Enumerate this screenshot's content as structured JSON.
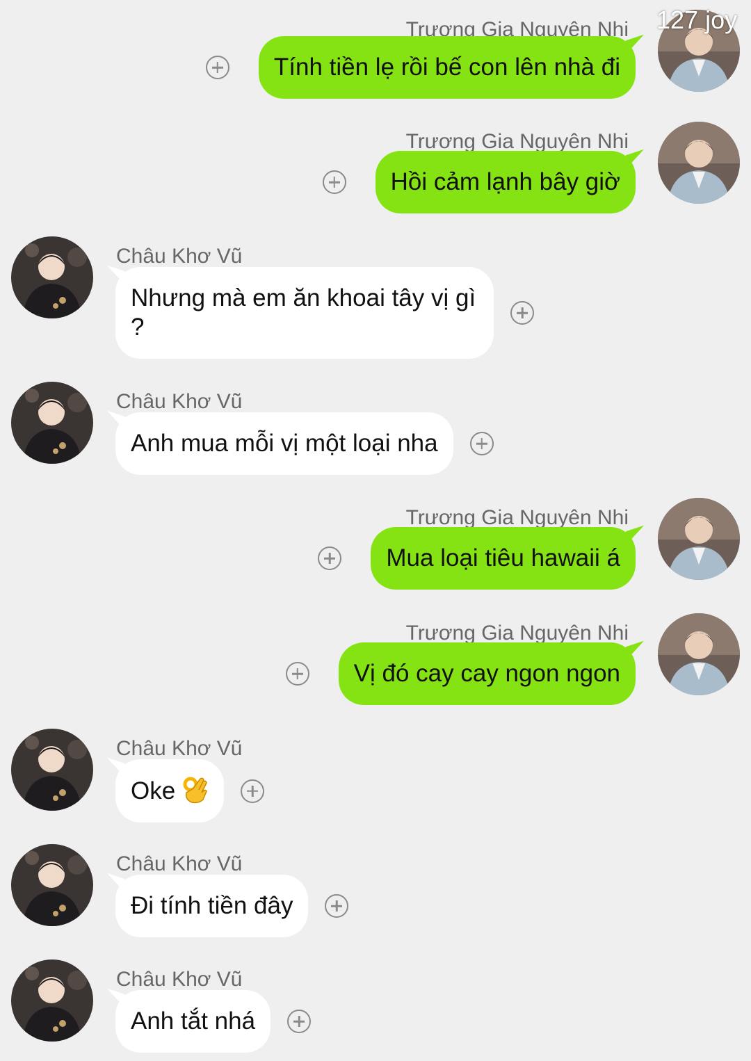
{
  "watermark": "127 joy",
  "colors": {
    "background": "#efefef",
    "outgoing_bubble": "#85e314",
    "incoming_bubble": "#ffffff",
    "sender_name": "#666666"
  },
  "messages": [
    {
      "side": "right",
      "sender": "Trương Gia Nguyên Nhi",
      "text": "Tính tiền lẹ rồi bế con lên nhà đi"
    },
    {
      "side": "right",
      "sender": "Trương Gia Nguyên Nhi",
      "text": "Hồi cảm lạnh bây giờ"
    },
    {
      "side": "left",
      "sender": "Châu Khơ Vũ",
      "text": "Nhưng mà em ăn khoai tây vị gì ?"
    },
    {
      "side": "left",
      "sender": "Châu Khơ Vũ",
      "text": "Anh mua mỗi vị một loại nha"
    },
    {
      "side": "right",
      "sender": "Trương Gia Nguyên Nhi",
      "text": "Mua loại tiêu hawaii á"
    },
    {
      "side": "right",
      "sender": "Trương Gia Nguyên Nhi",
      "text": "Vị đó cay cay ngon ngon"
    },
    {
      "side": "left",
      "sender": "Châu Khơ Vũ",
      "text": "Oke",
      "emoji": "ok-hand-emoji"
    },
    {
      "side": "left",
      "sender": "Châu Khơ Vũ",
      "text": "Đi tính tiền đây"
    },
    {
      "side": "left",
      "sender": "Châu Khơ Vũ",
      "text": "Anh tắt nhá"
    }
  ]
}
